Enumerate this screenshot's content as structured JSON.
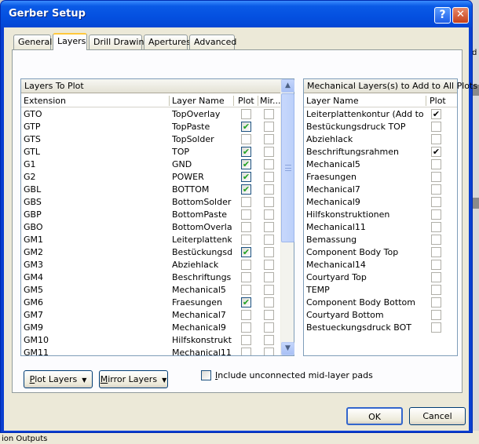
{
  "window": {
    "title": "Gerber Setup",
    "help_glyph": "?",
    "close_glyph": "✕"
  },
  "tabs": [
    {
      "label": "General",
      "active": false
    },
    {
      "label": "Layers",
      "active": true
    },
    {
      "label": "Drill Drawing",
      "active": false
    },
    {
      "label": "Apertures",
      "active": false
    },
    {
      "label": "Advanced",
      "active": false
    }
  ],
  "layers_to_plot": {
    "title": "Layers To Plot",
    "columns": {
      "extension": "Extension",
      "layer_name": "Layer Name",
      "plot": "Plot",
      "mirror": "Mir..."
    },
    "rows": [
      {
        "ext": "GTO",
        "name": "TopOverlay",
        "plot": false,
        "mirror": false
      },
      {
        "ext": "GTP",
        "name": "TopPaste",
        "plot": true,
        "mirror": false
      },
      {
        "ext": "GTS",
        "name": "TopSolder",
        "plot": false,
        "mirror": false
      },
      {
        "ext": "GTL",
        "name": "TOP",
        "plot": true,
        "mirror": false
      },
      {
        "ext": "G1",
        "name": "GND",
        "plot": true,
        "mirror": false
      },
      {
        "ext": "G2",
        "name": "POWER",
        "plot": true,
        "mirror": false
      },
      {
        "ext": "GBL",
        "name": "BOTTOM",
        "plot": true,
        "mirror": false
      },
      {
        "ext": "GBS",
        "name": "BottomSolder",
        "plot": false,
        "mirror": false
      },
      {
        "ext": "GBP",
        "name": "BottomPaste",
        "plot": false,
        "mirror": false
      },
      {
        "ext": "GBO",
        "name": "BottomOverlay",
        "plot": false,
        "mirror": false
      },
      {
        "ext": "GM1",
        "name": "Leiterplattenkont",
        "plot": false,
        "mirror": false
      },
      {
        "ext": "GM2",
        "name": "Bestückungsdru",
        "plot": true,
        "mirror": false
      },
      {
        "ext": "GM3",
        "name": "Abziehlack",
        "plot": false,
        "mirror": false
      },
      {
        "ext": "GM4",
        "name": "Beschriftungsrah",
        "plot": false,
        "mirror": false
      },
      {
        "ext": "GM5",
        "name": "Mechanical5",
        "plot": false,
        "mirror": false
      },
      {
        "ext": "GM6",
        "name": "Fraesungen",
        "plot": true,
        "mirror": false
      },
      {
        "ext": "GM7",
        "name": "Mechanical7",
        "plot": false,
        "mirror": false
      },
      {
        "ext": "GM9",
        "name": "Mechanical9",
        "plot": false,
        "mirror": false
      },
      {
        "ext": "GM10",
        "name": "Hilfskonstruktion",
        "plot": false,
        "mirror": false
      },
      {
        "ext": "GM11",
        "name": "Mechanical11",
        "plot": false,
        "mirror": false
      }
    ]
  },
  "mechanical_layers": {
    "title": "Mechanical Layers(s) to Add to All Plots",
    "columns": {
      "layer_name": "Layer Name",
      "plot": "Plot"
    },
    "rows": [
      {
        "name": "Leiterplattenkontur (Add to al",
        "plot": true
      },
      {
        "name": "Bestückungsdruck TOP",
        "plot": false
      },
      {
        "name": "Abziehlack",
        "plot": false
      },
      {
        "name": "Beschriftungsrahmen",
        "plot": true
      },
      {
        "name": "Mechanical5",
        "plot": false
      },
      {
        "name": "Fraesungen",
        "plot": false
      },
      {
        "name": "Mechanical7",
        "plot": false
      },
      {
        "name": "Mechanical9",
        "plot": false
      },
      {
        "name": "Hilfskonstruktionen",
        "plot": false
      },
      {
        "name": "Mechanical11",
        "plot": false
      },
      {
        "name": "Bemassung",
        "plot": false
      },
      {
        "name": "Component Body Top",
        "plot": false
      },
      {
        "name": "Mechanical14",
        "plot": false
      },
      {
        "name": "Courtyard Top",
        "plot": false
      },
      {
        "name": "TEMP",
        "plot": false
      },
      {
        "name": "Component Body Bottom",
        "plot": false
      },
      {
        "name": "Courtyard Bottom",
        "plot": false
      },
      {
        "name": "Bestueckungsdruck BOT",
        "plot": false
      }
    ]
  },
  "plot_layers_button": {
    "u": "P",
    "rest": "lot Layers"
  },
  "mirror_layers_button": {
    "u": "M",
    "rest": "irror Layers"
  },
  "include_unconnected": {
    "u": "I",
    "rest": "nclude unconnected mid-layer pads",
    "checked": false
  },
  "ok_label": "OK",
  "cancel_label": "Cancel",
  "background": {
    "bottom_text": "ion Outputs",
    "right_text": "d"
  }
}
